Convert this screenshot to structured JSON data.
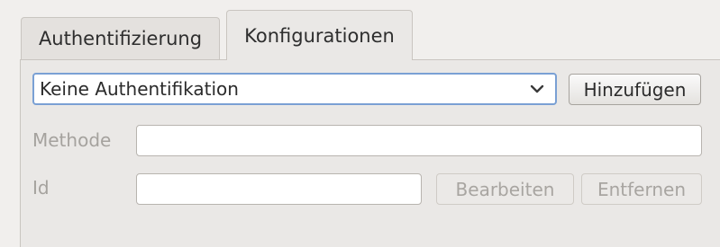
{
  "tabs": [
    {
      "label": "Authentifizierung",
      "active": false
    },
    {
      "label": "Konfigurationen",
      "active": true
    }
  ],
  "auth_select": {
    "selected": "Keine Authentifikation"
  },
  "buttons": {
    "add": "Hinzufügen",
    "edit": "Bearbeiten",
    "remove": "Entfernen"
  },
  "fields": {
    "method_label": "Methode",
    "method_value": "",
    "id_label": "Id",
    "id_value": ""
  },
  "colors": {
    "focus_border": "#7aa0d4",
    "disabled_text": "#a8a5a1",
    "panel_bg": "#eae8e6"
  }
}
